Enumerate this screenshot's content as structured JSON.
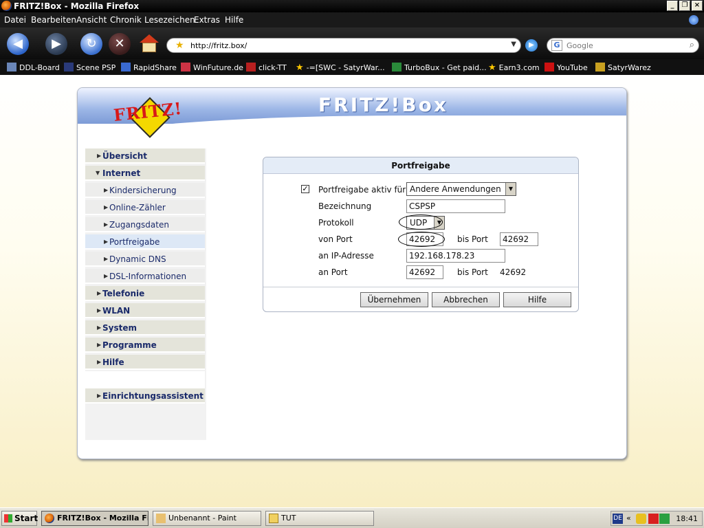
{
  "window": {
    "title": "FRITZ!Box - Mozilla Firefox"
  },
  "menu": [
    "Datei",
    "Bearbeiten",
    "Ansicht",
    "Chronik",
    "Lesezeichen",
    "Extras",
    "Hilfe"
  ],
  "address": {
    "url": "http://fritz.box/"
  },
  "search": {
    "placeholder": "Google"
  },
  "bookmarks": [
    "DDL-Board",
    "Scene PSP",
    "RapidShare",
    "WinFuture.de",
    "click-TT",
    "-=[SWC - SatyrWar...",
    "TurboBux - Get paid...",
    "Earn3.com",
    "YouTube",
    "SatyrWarez"
  ],
  "page": {
    "logo_text": "FRITZ!",
    "brand_text": "FRITZ!Box",
    "sidebar": [
      {
        "label": "Übersicht",
        "level": "top"
      },
      {
        "label": "Internet",
        "level": "top"
      },
      {
        "label": "Kindersicherung",
        "level": "sub"
      },
      {
        "label": "Online-Zähler",
        "level": "sub"
      },
      {
        "label": "Zugangsdaten",
        "level": "sub"
      },
      {
        "label": "Portfreigabe",
        "level": "sub"
      },
      {
        "label": "Dynamic DNS",
        "level": "sub"
      },
      {
        "label": "DSL-Informationen",
        "level": "sub"
      },
      {
        "label": "Telefonie",
        "level": "top"
      },
      {
        "label": "WLAN",
        "level": "top"
      },
      {
        "label": "System",
        "level": "top"
      },
      {
        "label": "Programme",
        "level": "top"
      },
      {
        "label": "Hilfe",
        "level": "top"
      },
      {
        "label": "Einrichtungsassistent",
        "level": "top"
      }
    ],
    "panel": {
      "title": "Portfreigabe",
      "active_label": "Portfreigabe aktiv für",
      "active_checked": "✓",
      "active_value": "Andere Anwendungen",
      "name_label": "Bezeichnung",
      "name_value": "CSPSP",
      "protocol_label": "Protokoll",
      "protocol_value": "UDP",
      "from_port_label": "von Port",
      "from_port_value": "42692",
      "to_port_label": "bis Port",
      "to_port_value": "42692",
      "ip_label": "an IP-Adresse",
      "ip_value": "192.168.178.23",
      "target_port_label": "an Port",
      "target_port_value": "42692",
      "target_to_label": "bis Port",
      "target_to_value": "42692",
      "buttons": {
        "apply": "Übernehmen",
        "cancel": "Abbrechen",
        "help": "Hilfe"
      }
    }
  },
  "taskbar": {
    "start": "Start",
    "tasks": [
      "FRITZ!Box - Mozilla Fi...",
      "Unbenannt - Paint",
      "TUT"
    ],
    "tray_lang": "DE",
    "clock": "18:41"
  }
}
